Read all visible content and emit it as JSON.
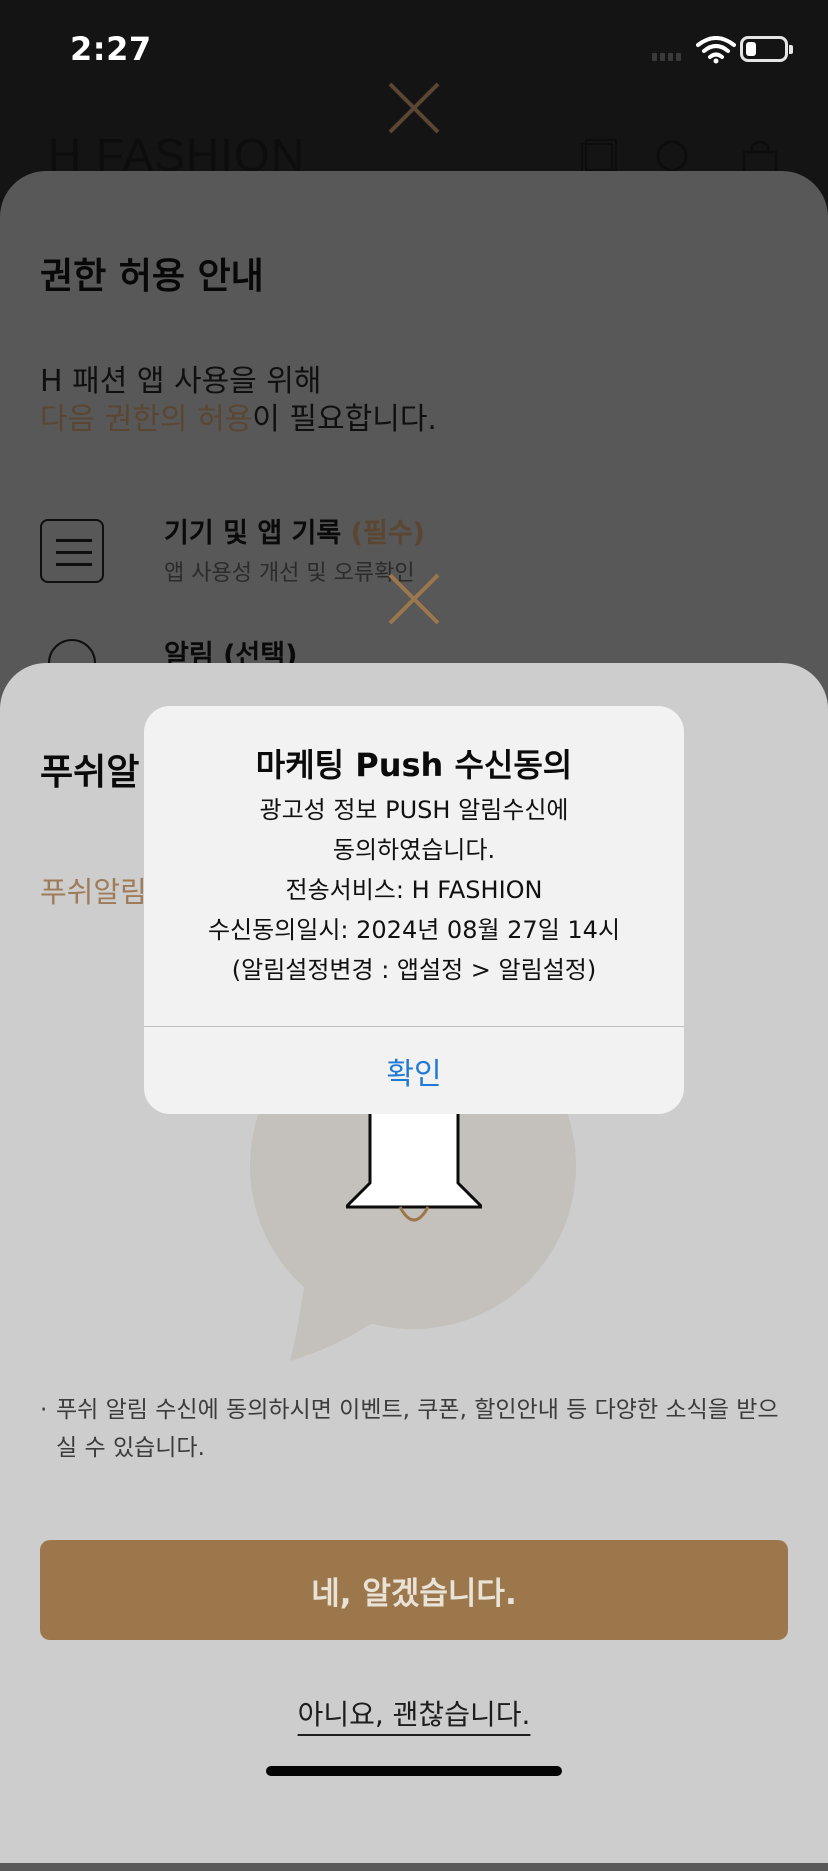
{
  "status_bar": {
    "time": "2:27"
  },
  "app_header": {
    "logo": "H FASHION"
  },
  "permission_sheet": {
    "title": "권한 허용 안내",
    "desc_line1": "H 패션 앱 사용을 위해",
    "desc_highlight": "다음 권한의 허용",
    "desc_rest": "이 필요합니다.",
    "items": [
      {
        "title": "기기 및 앱 기록",
        "tag": "(필수)",
        "subtitle": "앱 사용성 개선 및 오류확인"
      },
      {
        "title": "알림 (선택)"
      }
    ]
  },
  "push_sheet": {
    "title": "푸쉬알",
    "subtitle": "푸쉬알림",
    "note_bullet": "·",
    "note": "푸쉬 알림 수신에 동의하시면 이벤트, 쿠폰, 할인안내 등 다양한 소식을 받으실 수 있습니다.",
    "yes_label": "네, 알겠습니다.",
    "no_label": "아니요, 괜찮습니다."
  },
  "alert": {
    "title": "마케팅 Push 수신동의",
    "lines": [
      "광고성 정보 PUSH 알림수신에",
      "동의하였습니다.",
      "전송서비스: H FASHION",
      "수신동의일시: 2024년 08월 27일 14시",
      "(알림설정변경 : 앱설정 > 알림설정)"
    ],
    "confirm_label": "확인"
  },
  "colors": {
    "accent_brown": "#9c774c",
    "alert_button": "#1f7ad6"
  }
}
